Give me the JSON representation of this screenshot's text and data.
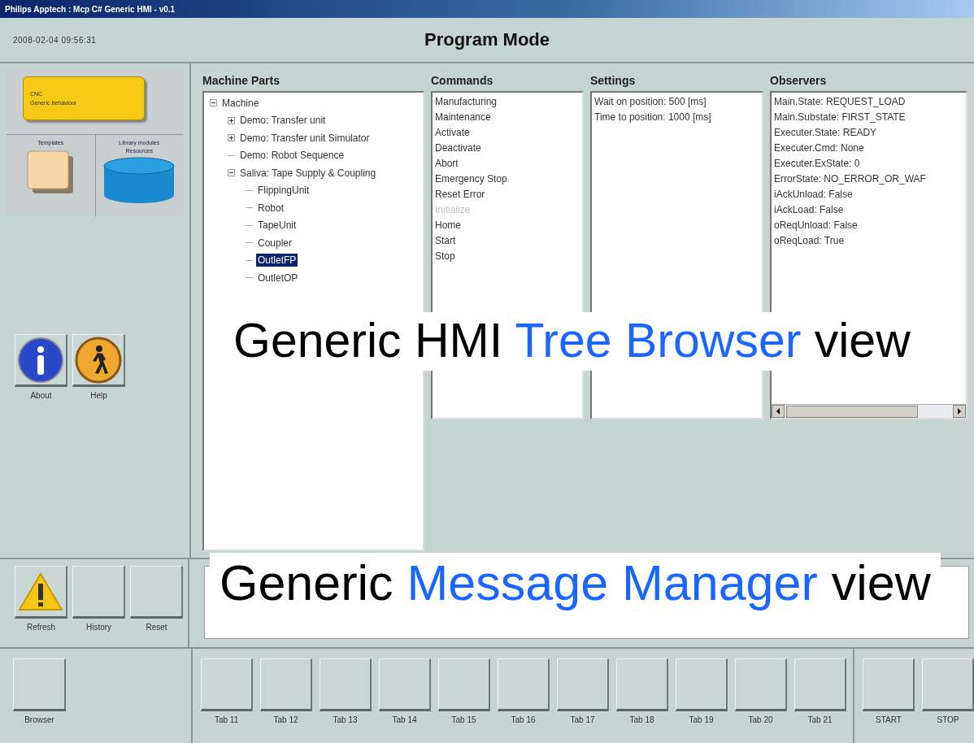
{
  "window": {
    "title": "Philips Apptech : Mcp C# Generic HMI - v0.1"
  },
  "header": {
    "timestamp": "2008-02-04 09:56:31",
    "mode": "Program Mode"
  },
  "sidebar": {
    "diagram": {
      "folder_caption": "CNC",
      "folder_label": "Generic behaviour",
      "left_label": "Templates",
      "right_label": "Library modules",
      "right_sublabel": "Resources"
    },
    "buttons": [
      {
        "label": "About",
        "kind": "info"
      },
      {
        "label": "Help",
        "kind": "help"
      }
    ]
  },
  "panels": {
    "machine_parts": {
      "title": "Machine Parts",
      "tree": [
        {
          "label": "Machine",
          "expanded": true,
          "selected": false,
          "children": [
            {
              "label": "Demo: Transfer unit",
              "expanded": false,
              "selected": false
            },
            {
              "label": "Demo: Transfer unit Simulator",
              "expanded": false,
              "selected": false
            },
            {
              "label": "Demo: Robot Sequence",
              "selected": false
            },
            {
              "label": "Saliva: Tape Supply & Coupling",
              "expanded": true,
              "selected": false,
              "children": [
                {
                  "label": "FlippingUnit",
                  "selected": false
                },
                {
                  "label": "Robot",
                  "selected": false
                },
                {
                  "label": "TapeUnit",
                  "selected": false
                },
                {
                  "label": "Coupler",
                  "selected": false
                },
                {
                  "label": "OutletFP",
                  "selected": true
                },
                {
                  "label": "OutletOP",
                  "selected": false
                }
              ]
            }
          ]
        }
      ]
    },
    "commands": {
      "title": "Commands",
      "items": [
        {
          "label": "Manufacturing",
          "disabled": false
        },
        {
          "label": "Maintenance",
          "disabled": false
        },
        {
          "label": "Activate",
          "disabled": false
        },
        {
          "label": "Deactivate",
          "disabled": false
        },
        {
          "label": "Abort",
          "disabled": false
        },
        {
          "label": "Emergency Stop",
          "disabled": false
        },
        {
          "label": "Reset Error",
          "disabled": false
        },
        {
          "label": "Initialize",
          "disabled": true
        },
        {
          "label": "Home",
          "disabled": false
        },
        {
          "label": "Start",
          "disabled": false
        },
        {
          "label": "Stop",
          "disabled": false
        }
      ]
    },
    "settings": {
      "title": "Settings",
      "items": [
        "Wait on position: 500 [ms]",
        "Time to position: 1000 [ms]"
      ]
    },
    "observers": {
      "title": "Observers",
      "items": [
        "Main.State: REQUEST_LOAD",
        "Main.Substate: FIRST_STATE",
        "Executer.State: READY",
        "Executer.Cmd: None",
        "Executer.ExState: 0",
        "ErrorState: NO_ERROR_OR_WAF",
        "iAckUnload: False",
        "iAckLoad: False",
        "oReqUnload: False",
        "oReqLoad: True"
      ]
    }
  },
  "message_buttons": [
    {
      "label": "Refresh",
      "kind": "warning"
    },
    {
      "label": "History",
      "kind": "plain"
    },
    {
      "label": "Reset",
      "kind": "plain"
    }
  ],
  "bottom_bar": {
    "left": [
      "Browser"
    ],
    "tabs": [
      "Tab 11",
      "Tab 12",
      "Tab 13",
      "Tab 14",
      "Tab 15",
      "Tab 16",
      "Tab 17",
      "Tab 18",
      "Tab 19",
      "Tab 20",
      "Tab 21"
    ],
    "right": [
      "START",
      "STOP"
    ]
  },
  "annotations": [
    {
      "kind": "tree",
      "parts": [
        {
          "text": "Generic HMI ",
          "accent": false
        },
        {
          "text": "Tree Browser",
          "accent": true
        },
        {
          "text": " view",
          "accent": false
        }
      ]
    },
    {
      "kind": "message",
      "parts": [
        {
          "text": "Generic ",
          "accent": false
        },
        {
          "text": "Message Manager",
          "accent": true
        },
        {
          "text": " view",
          "accent": false
        }
      ]
    }
  ]
}
